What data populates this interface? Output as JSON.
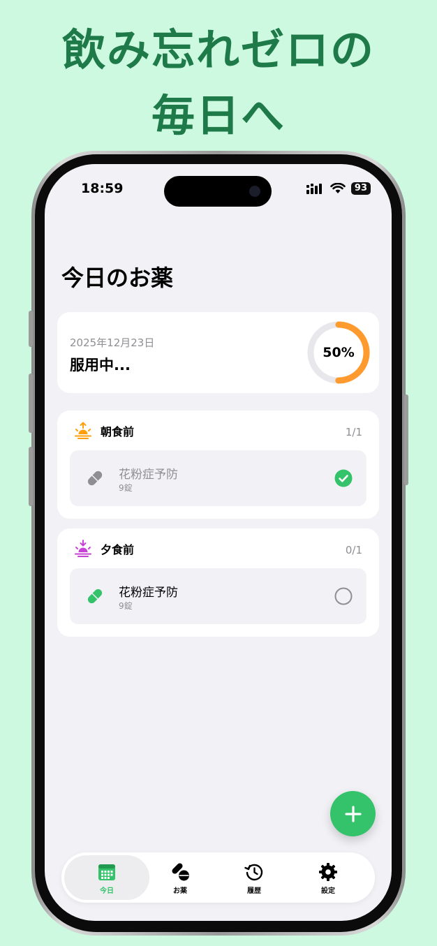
{
  "headline": {
    "line1": "飲み忘れゼロの",
    "line2": "毎日へ"
  },
  "status_bar": {
    "time": "18:59",
    "battery": "93"
  },
  "page": {
    "title": "今日のお薬"
  },
  "summary": {
    "date": "2025年12月23日",
    "status": "服用中...",
    "progress_label": "50%",
    "progress_fraction": 0.5
  },
  "slots": [
    {
      "name": "朝食前",
      "count": "1/1",
      "icon": "sunrise-icon",
      "icon_color": "#ff9f0a",
      "medication": {
        "name": "花粉症予防",
        "dose": "9錠",
        "taken": true
      }
    },
    {
      "name": "夕食前",
      "count": "0/1",
      "icon": "sunset-icon",
      "icon_color": "#c643d6",
      "medication": {
        "name": "花粉症予防",
        "dose": "9錠",
        "taken": false
      }
    }
  ],
  "fab": {
    "icon": "plus-icon"
  },
  "tabs": [
    {
      "label": "今日",
      "icon": "calendar-icon",
      "active": true
    },
    {
      "label": "お薬",
      "icon": "pills-icon",
      "active": false
    },
    {
      "label": "履歴",
      "icon": "history-icon",
      "active": false
    },
    {
      "label": "設定",
      "icon": "gear-icon",
      "active": false
    }
  ],
  "colors": {
    "accent": "#34c26a",
    "progress": "#ff9a2e",
    "background": "#ccf9df",
    "headline": "#1f7a4a"
  }
}
